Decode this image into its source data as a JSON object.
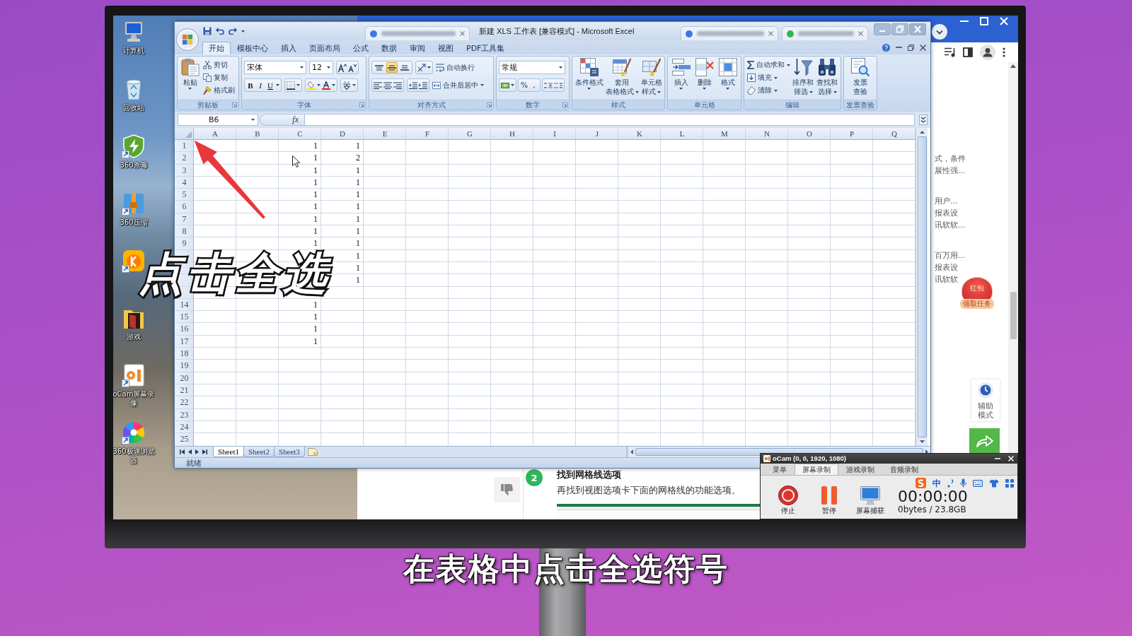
{
  "desktop": {
    "icons": [
      {
        "kind": "computer",
        "label": "计算机",
        "shortcut": false
      },
      {
        "kind": "recycle",
        "label": "回收站",
        "shortcut": false
      },
      {
        "kind": "shield",
        "label": "360杀毒",
        "shortcut": true
      },
      {
        "kind": "archive",
        "label": "360压缩",
        "shortcut": true
      },
      {
        "kind": "music",
        "shortcut": true
      },
      {
        "kind": "folder",
        "label": "游戏",
        "shortcut": false
      },
      {
        "kind": "recorder",
        "label": "oCam屏幕录像",
        "shortcut": true
      },
      {
        "kind": "browser",
        "label": "360极速浏览器",
        "shortcut": true
      }
    ]
  },
  "excel": {
    "title": "新建 XLS 工作表 [兼容模式] - Microsoft Excel",
    "tabs": [
      {
        "label": "开始",
        "selected": true
      },
      {
        "label": "模板中心",
        "selected": false
      },
      {
        "label": "插入",
        "selected": false
      },
      {
        "label": "页面布局",
        "selected": false
      },
      {
        "label": "公式",
        "selected": false
      },
      {
        "label": "数据",
        "selected": false
      },
      {
        "label": "审阅",
        "selected": false
      },
      {
        "label": "视图",
        "selected": false
      },
      {
        "label": "PDF工具集",
        "selected": false
      }
    ],
    "ribbon": [
      {
        "kind": "buttons",
        "label": "剪贴板",
        "dialog_launcher": true,
        "controls": [
          {
            "kind": "paste",
            "lines": [
              "粘贴"
            ],
            "menu": true
          },
          {
            "kind": "cut",
            "lines": [
              "剪切"
            ],
            "menu": false
          },
          {
            "kind": "copy",
            "lines": [
              "复制"
            ],
            "menu": false
          },
          {
            "kind": "brush",
            "lines": [
              "格式刷"
            ],
            "menu": false
          }
        ]
      },
      {
        "kind": "font",
        "label": "字体",
        "dialog_launcher": true,
        "font": "宋体",
        "size": "12",
        "styles": [
          "B",
          "I",
          "U"
        ]
      },
      {
        "kind": "alignment",
        "label": "对齐方式",
        "dialog_launcher": true,
        "vertical": [
          {
            "selected": false
          },
          {
            "selected": true
          },
          {
            "selected": false
          }
        ],
        "wrap": "自动换行",
        "merge": "合并后居中"
      },
      {
        "kind": "number",
        "label": "数字",
        "dialog_launcher": true,
        "format": "常规",
        "symbols": [
          "%",
          ","
        ]
      },
      {
        "kind": "buttons",
        "label": "样式",
        "dialog_launcher": false,
        "controls": [
          {
            "kind": "conditional",
            "lines": [
              "条件格式"
            ],
            "menu": true
          },
          {
            "kind": "table",
            "lines": [
              "套用",
              "表格格式"
            ],
            "menu": true
          },
          {
            "kind": "cellstyle",
            "lines": [
              "单元格",
              "样式"
            ],
            "menu": true
          }
        ]
      },
      {
        "kind": "buttons",
        "label": "单元格",
        "dialog_launcher": false,
        "controls": [
          {
            "kind": "insert",
            "lines": [
              "插入"
            ],
            "menu": true
          },
          {
            "kind": "delete",
            "lines": [
              "删除"
            ],
            "menu": true
          },
          {
            "kind": "format",
            "lines": [
              "格式"
            ],
            "menu": true
          }
        ]
      },
      {
        "kind": "buttons",
        "label": "编辑",
        "dialog_launcher": false,
        "controls": [
          {
            "kind": "sum",
            "lines": [
              "自动求和"
            ],
            "menu": true
          },
          {
            "kind": "fill",
            "lines": [
              "填充"
            ],
            "menu": true
          },
          {
            "kind": "clear",
            "lines": [
              "清除"
            ],
            "menu": true
          },
          {
            "kind": "sort",
            "lines": [
              "排序和",
              "筛选"
            ],
            "menu": true
          },
          {
            "kind": "find",
            "lines": [
              "查找和",
              "选择"
            ],
            "menu": true
          }
        ]
      },
      {
        "kind": "buttons",
        "label": "发票查验",
        "dialog_launcher": false,
        "controls": [
          {
            "kind": "invoice",
            "lines": [
              "发票",
              "查验"
            ],
            "menu": false
          }
        ]
      }
    ],
    "name_box": "B6",
    "function_label": "fx",
    "columns": [
      "A",
      "B",
      "C",
      "D",
      "E",
      "F",
      "G",
      "H",
      "I",
      "J",
      "K",
      "L",
      "M",
      "N",
      "O",
      "P",
      "Q"
    ],
    "rows": [
      {
        "number": "1",
        "c": "1",
        "d": "1"
      },
      {
        "number": "2",
        "c": "1",
        "d": "2"
      },
      {
        "number": "3",
        "c": "1",
        "d": "1"
      },
      {
        "number": "4",
        "c": "1",
        "d": "1"
      },
      {
        "number": "5",
        "c": "1",
        "d": "1"
      },
      {
        "number": "6",
        "c": "1",
        "d": "1"
      },
      {
        "number": "7",
        "c": "1",
        "d": "1"
      },
      {
        "number": "8",
        "c": "1",
        "d": "1"
      },
      {
        "number": "9",
        "c": "1",
        "d": "1"
      },
      {
        "d": "1"
      },
      {
        "d": "1"
      },
      {
        "d": "1"
      },
      {},
      {
        "number": "14",
        "c": "1"
      },
      {
        "number": "15",
        "c": "1"
      },
      {
        "number": "16",
        "c": "1"
      },
      {
        "number": "17",
        "c": "1"
      },
      {
        "number": "18"
      },
      {
        "number": "19"
      },
      {
        "number": "20"
      },
      {
        "number": "21"
      },
      {
        "number": "22"
      },
      {
        "number": "23"
      },
      {
        "number": "24"
      },
      {
        "number": "25"
      }
    ],
    "sheets": [
      {
        "label": "Sheet1",
        "selected": true
      },
      {
        "label": "Sheet2",
        "selected": false
      },
      {
        "label": "Sheet3",
        "selected": false
      }
    ],
    "status": "就绪"
  },
  "browser": {
    "snippets": [
      [
        "式，条件",
        "展性强..."
      ],
      [
        "用户...",
        "报表设",
        "讯软软..."
      ],
      [
        "百万用...",
        "报表设",
        "讯软软"
      ]
    ],
    "red_packet": {
      "title": "红包",
      "action": "领取任务"
    },
    "assist": [
      "辅助",
      "模式"
    ],
    "step": {
      "number": "2",
      "title": "找到网格线选项",
      "text": "再找到视图选项卡下面的网格线的功能选项。"
    }
  },
  "ocam": {
    "title": "oCam (0, 0, 1920, 1080)",
    "tabs": [
      {
        "label": "菜单",
        "selected": false
      },
      {
        "label": "屏幕录制",
        "selected": true
      },
      {
        "label": "游戏录制",
        "selected": false
      },
      {
        "label": "音频录制",
        "selected": false
      }
    ],
    "actions": [
      {
        "kind": "stop",
        "label": "停止"
      },
      {
        "kind": "pause",
        "label": "暂停"
      },
      {
        "kind": "capture",
        "label": "屏幕捕获"
      }
    ],
    "timer": "00:00:00",
    "storage": "0bytes / 23.8GB",
    "ime_mode": "中"
  },
  "callout": "点击全选",
  "caption": "在表格中点击全选符号"
}
